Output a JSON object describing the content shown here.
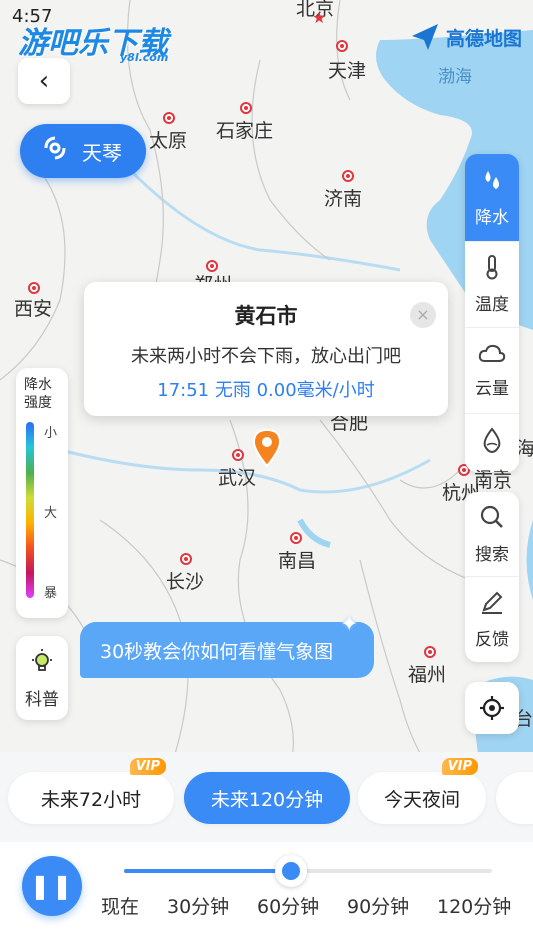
{
  "status": {
    "time": "4:57"
  },
  "brand": {
    "logo": "游吧乐下载",
    "logo_sub": "y8l.com",
    "map_brand": "高德地图"
  },
  "map": {
    "cities": [
      {
        "id": "beijing",
        "name": "北京"
      },
      {
        "id": "tianjin",
        "name": "天津"
      },
      {
        "id": "taiyuan",
        "name": "太原"
      },
      {
        "id": "shijiazhuang",
        "name": "石家庄"
      },
      {
        "id": "jinan",
        "name": "济南"
      },
      {
        "id": "zhengzhou",
        "name": "郑州"
      },
      {
        "id": "xian",
        "name": "西安"
      },
      {
        "id": "hefei",
        "name": "合肥"
      },
      {
        "id": "wuhan",
        "name": "武汉"
      },
      {
        "id": "hangzhou",
        "name": "杭州"
      },
      {
        "id": "nanchang",
        "name": "南昌"
      },
      {
        "id": "changsha",
        "name": "长沙"
      },
      {
        "id": "fuzhou",
        "name": "福州"
      }
    ],
    "sea_label": "渤海",
    "edge_labels": {
      "shanghai": "海",
      "nanjing": "南京",
      "taibei": "台北"
    }
  },
  "typhoon_button": {
    "label": "天琴"
  },
  "layers": [
    {
      "id": "precip",
      "label": "降水",
      "icon": "rain-drops-icon",
      "active": true
    },
    {
      "id": "temp",
      "label": "温度",
      "icon": "thermometer-icon",
      "active": false
    },
    {
      "id": "cloud",
      "label": "云量",
      "icon": "cloud-icon",
      "active": false
    },
    {
      "id": "humidity",
      "label": "湿度",
      "icon": "water-drop-icon",
      "active": false
    }
  ],
  "tools": [
    {
      "id": "search",
      "label": "搜索",
      "icon": "search-icon"
    },
    {
      "id": "feedback",
      "label": "反馈",
      "icon": "pencil-icon"
    }
  ],
  "legend": {
    "title": "降水强度",
    "levels": [
      "小",
      "大",
      "暴"
    ]
  },
  "science": {
    "label": "科普",
    "icon": "lightbulb-icon"
  },
  "tutorial": {
    "label": "30秒教会你如何看懂气象图"
  },
  "popup": {
    "city": "黄石市",
    "message": "未来两小时不会下雨，放心出门吧",
    "detail": "17:51 无雨  0.00毫米/小时",
    "close": "×"
  },
  "tabs": [
    {
      "label": "未来72小时",
      "vip": "VIP",
      "active": false
    },
    {
      "label": "未来120分钟",
      "vip": "",
      "active": true
    },
    {
      "label": "今天夜间",
      "vip": "VIP",
      "active": false
    }
  ],
  "timeline": {
    "play_state": "paused",
    "progress": 0.5,
    "ticks": [
      "现在",
      "30分钟",
      "60分钟",
      "90分钟",
      "120分钟"
    ]
  },
  "colors": {
    "accent": "#3a8bf5",
    "water": "#9fd4f2",
    "city_marker": "#e0363e",
    "vip": "#ff9800"
  }
}
